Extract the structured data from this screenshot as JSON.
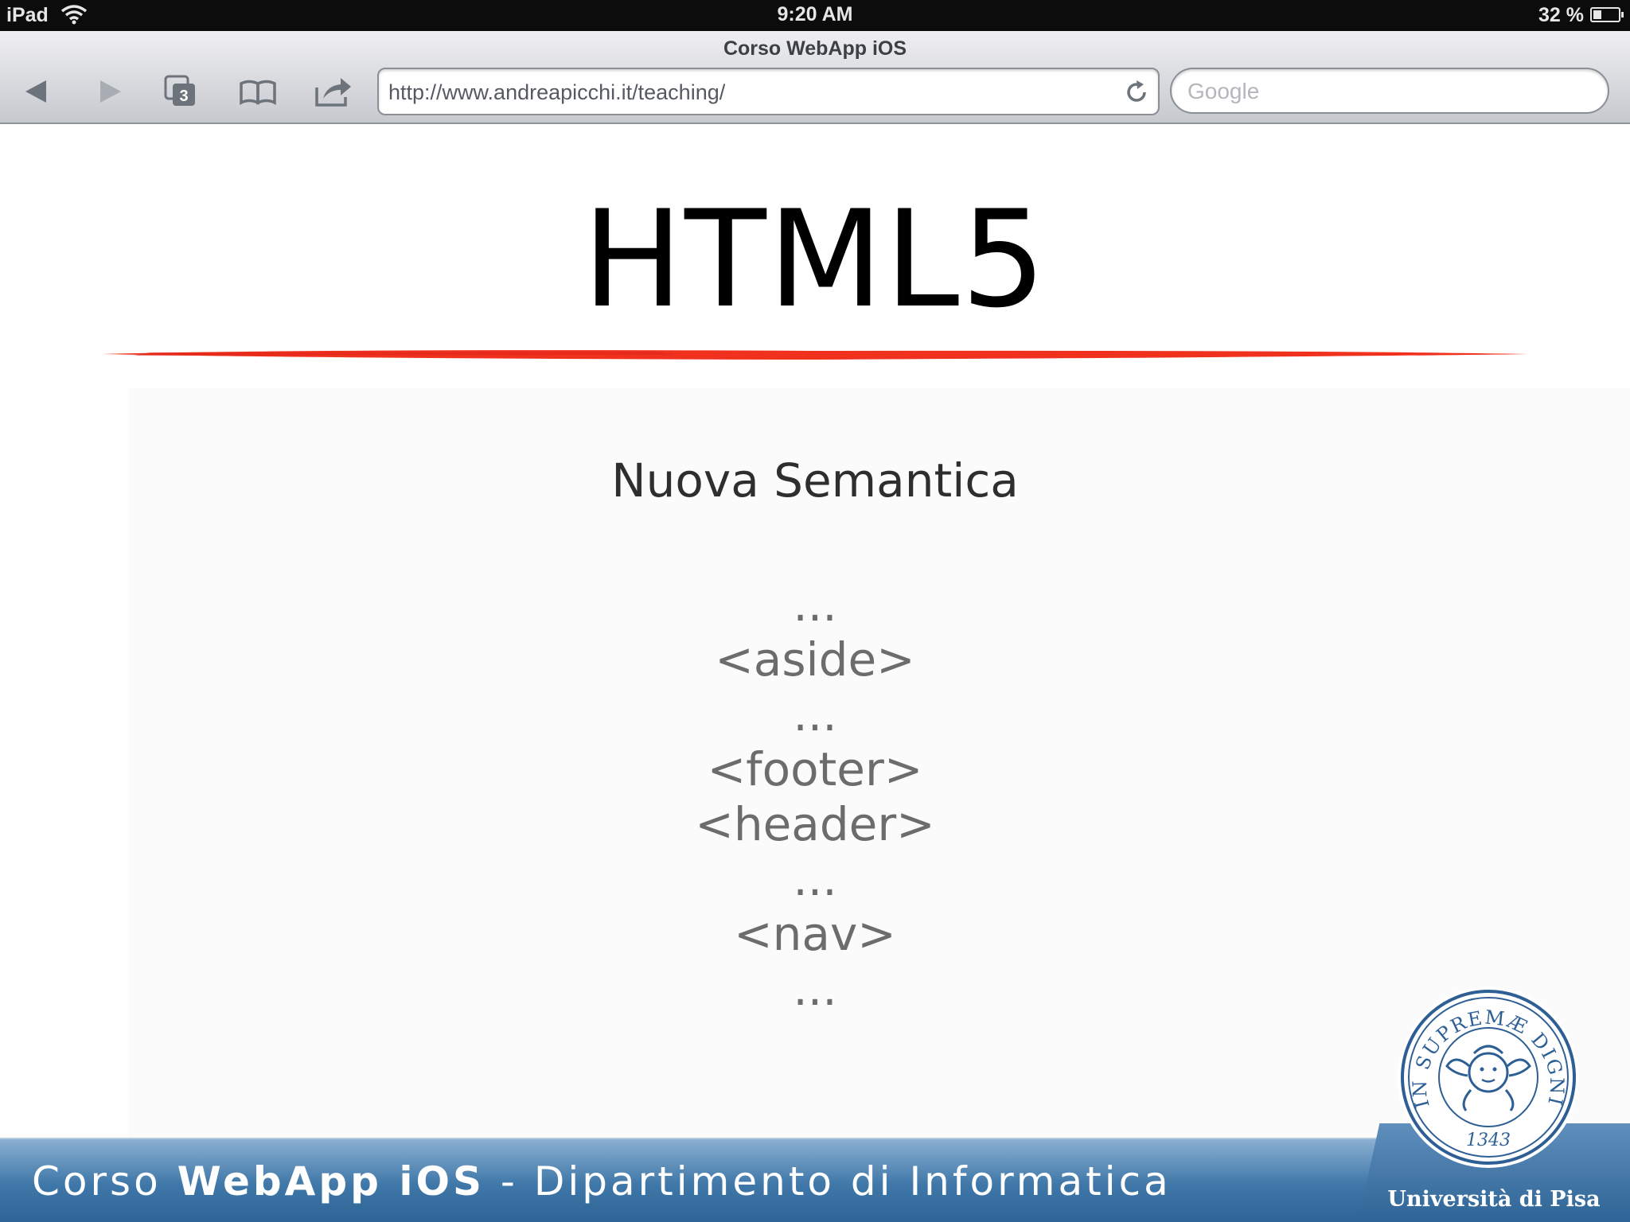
{
  "status_bar": {
    "carrier": "iPad",
    "time": "9:20 AM",
    "battery": "32 %",
    "battery_level_percent": 32
  },
  "browser": {
    "page_title": "Corso WebApp iOS",
    "url": "http://www.andreapicchi.it/teaching/",
    "search_placeholder": "Google",
    "tab_count": "3",
    "icons": {
      "back": "back-arrow-icon",
      "forward": "forward-arrow-icon",
      "tabs": "tabs-icon",
      "bookmarks": "bookmarks-book-icon",
      "share": "share-icon",
      "reload": "reload-icon",
      "wifi": "wifi-icon",
      "battery": "battery-icon"
    }
  },
  "slide": {
    "title": "HTML5",
    "subtitle": "Nuova Semantica",
    "tags": [
      "...",
      "<aside>",
      "...",
      "<footer>",
      "<header>",
      "...",
      "<nav>",
      "..."
    ],
    "accent_color": "#f0311e"
  },
  "footer": {
    "prefix": "Corso ",
    "bold": "WebApp iOS",
    "suffix": " - Dipartimento di Informatica",
    "university": "Università di Pisa",
    "seal_text": "IN SUPREMÆ DIGNITATIS",
    "seal_year": "1343",
    "bar_color": "#3f77a8"
  }
}
